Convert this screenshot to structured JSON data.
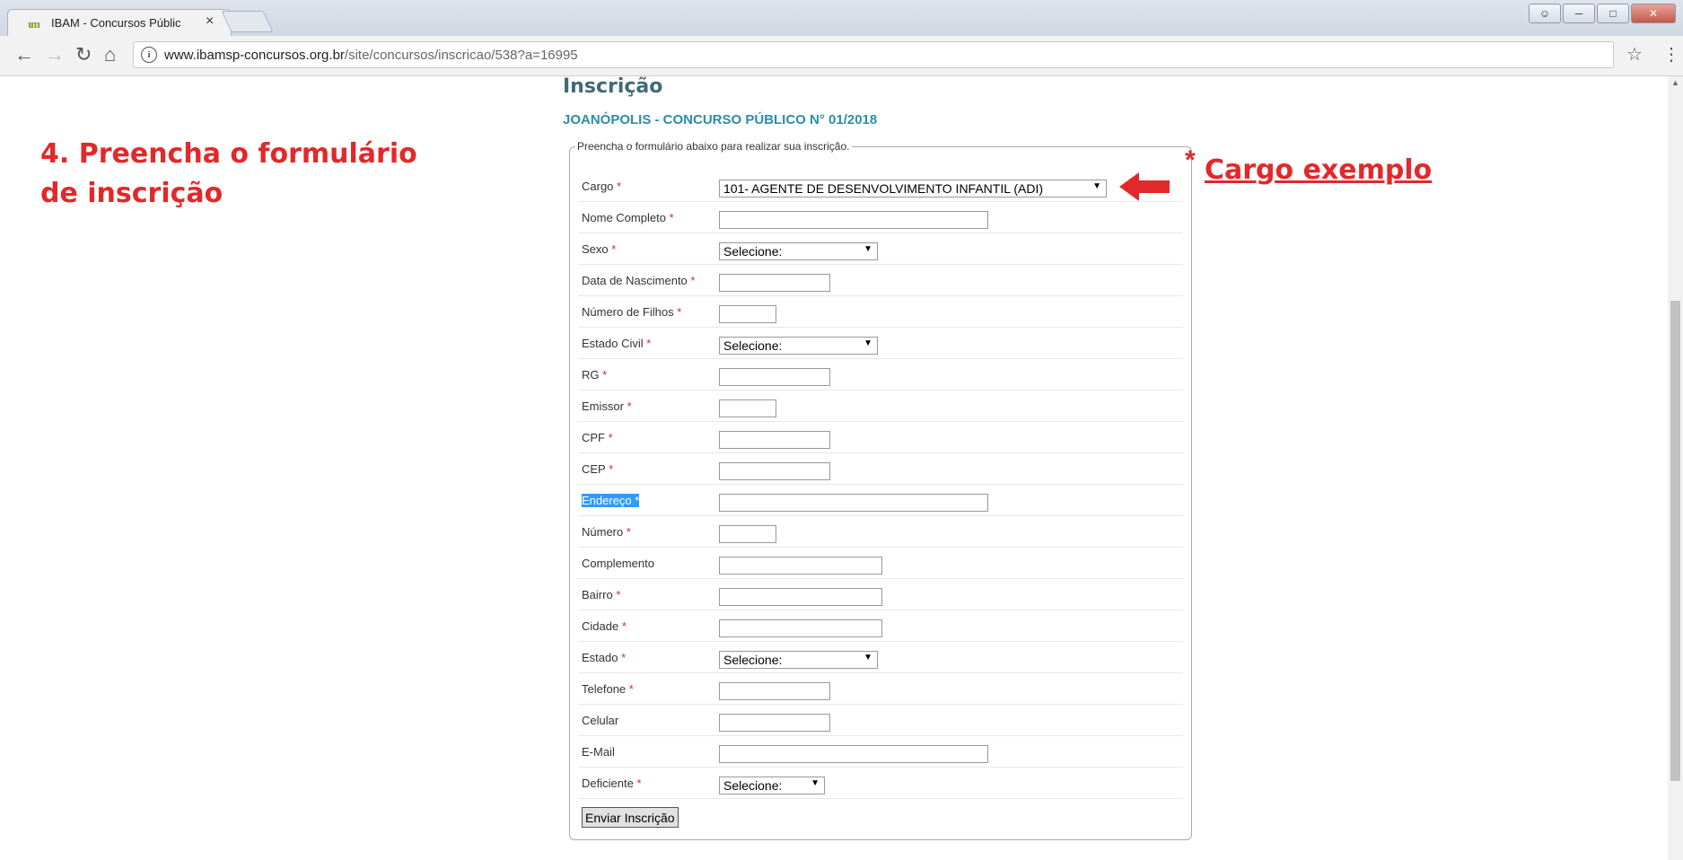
{
  "browser": {
    "tab_title": "IBAM - Concursos Públic",
    "tab_close": "×",
    "favicon_text": "ιm",
    "url_host": "www.ibamsp-concursos.org.br",
    "url_path": "/site/concursos/inscricao/538?a=16995"
  },
  "annotation": {
    "step_title": "4. Preencha o formulário de inscrição",
    "cargo_callout": "Cargo exemplo",
    "asterisk": "*",
    "color": "#e2282a"
  },
  "page": {
    "heading": "Inscrição",
    "contest": "JOANÓPOLIS - CONCURSO PÚBLICO N° 01/2018",
    "legend": "Preencha o formulário abaixo para realizar sua inscrição."
  },
  "form": {
    "required_mark": "*",
    "fields": [
      {
        "label": "Cargo",
        "required": true,
        "type": "select",
        "value": "101- AGENTE DE DESENVOLVIMENTO INFANTIL (ADI)"
      },
      {
        "label": "Nome Completo",
        "required": true,
        "type": "text",
        "value": ""
      },
      {
        "label": "Sexo",
        "required": true,
        "type": "select",
        "value": "Selecione:"
      },
      {
        "label": "Data de Nascimento",
        "required": true,
        "type": "text",
        "value": ""
      },
      {
        "label": "Número de Filhos",
        "required": true,
        "type": "text",
        "value": ""
      },
      {
        "label": "Estado Civil",
        "required": true,
        "type": "select",
        "value": "Selecione:"
      },
      {
        "label": "RG",
        "required": true,
        "type": "text",
        "value": ""
      },
      {
        "label": "Emissor",
        "required": true,
        "type": "text",
        "value": ""
      },
      {
        "label": "CPF",
        "required": true,
        "type": "text",
        "value": ""
      },
      {
        "label": "CEP",
        "required": true,
        "type": "text",
        "value": ""
      },
      {
        "label": "Endereço",
        "required": true,
        "type": "text",
        "value": "",
        "highlighted": true
      },
      {
        "label": "Número",
        "required": true,
        "type": "text",
        "value": ""
      },
      {
        "label": "Complemento",
        "required": false,
        "type": "text",
        "value": ""
      },
      {
        "label": "Bairro",
        "required": true,
        "type": "text",
        "value": ""
      },
      {
        "label": "Cidade",
        "required": true,
        "type": "text",
        "value": ""
      },
      {
        "label": "Estado",
        "required": true,
        "type": "select",
        "value": "Selecione:"
      },
      {
        "label": "Telefone",
        "required": true,
        "type": "text",
        "value": ""
      },
      {
        "label": "Celular",
        "required": false,
        "type": "text",
        "value": ""
      },
      {
        "label": "E-Mail",
        "required": false,
        "type": "text",
        "value": ""
      },
      {
        "label": "Deficiente",
        "required": true,
        "type": "select",
        "value": "Selecione:"
      }
    ],
    "submit_label": "Enviar Inscrição"
  }
}
